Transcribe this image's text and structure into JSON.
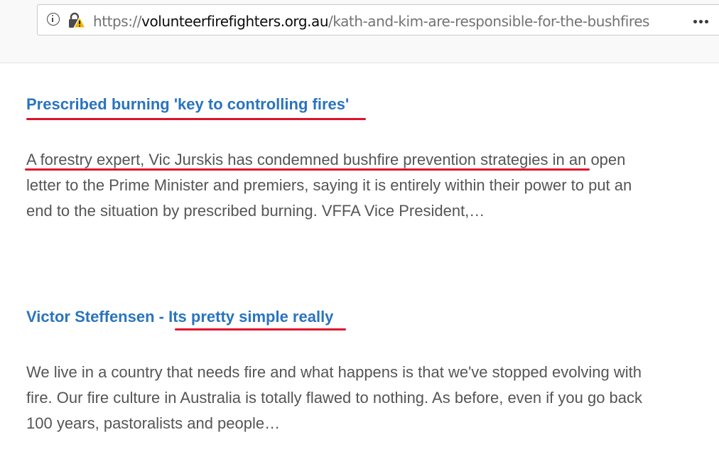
{
  "browser": {
    "url_scheme": "https://",
    "url_domain": "volunteerfirefighters.org.au",
    "url_path": "/kath-and-kim-are-responsible-for-the-bushfires",
    "icons": [
      "info-icon",
      "lock-warning-icon",
      "more-options-icon"
    ]
  },
  "articles": [
    {
      "title": "Prescribed burning 'key to controlling fires'",
      "body_lines": [
        "A forestry expert, Vic Jurskis has condemned bushfire prevention strategies in an open",
        "letter to the Prime Minister and premiers, saying it is entirely within their power to put an",
        "end to the situation by prescribed burning. VFFA Vice President,…"
      ]
    },
    {
      "title_prefix": "Victor Steffensen - ",
      "title_link": "Its pretty simple really",
      "body_lines": [
        "We live in a country that needs fire and what happens is that we've stopped evolving with",
        "fire. Our fire culture in Australia is totally flawed to nothing. As before, even if you go back",
        "100 years, pastoralists and people…"
      ]
    }
  ],
  "colors": {
    "link": "#2a74be",
    "body_text": "#555555",
    "annotation_underline": "#e0112b",
    "lock_warning": "#f5b400"
  }
}
